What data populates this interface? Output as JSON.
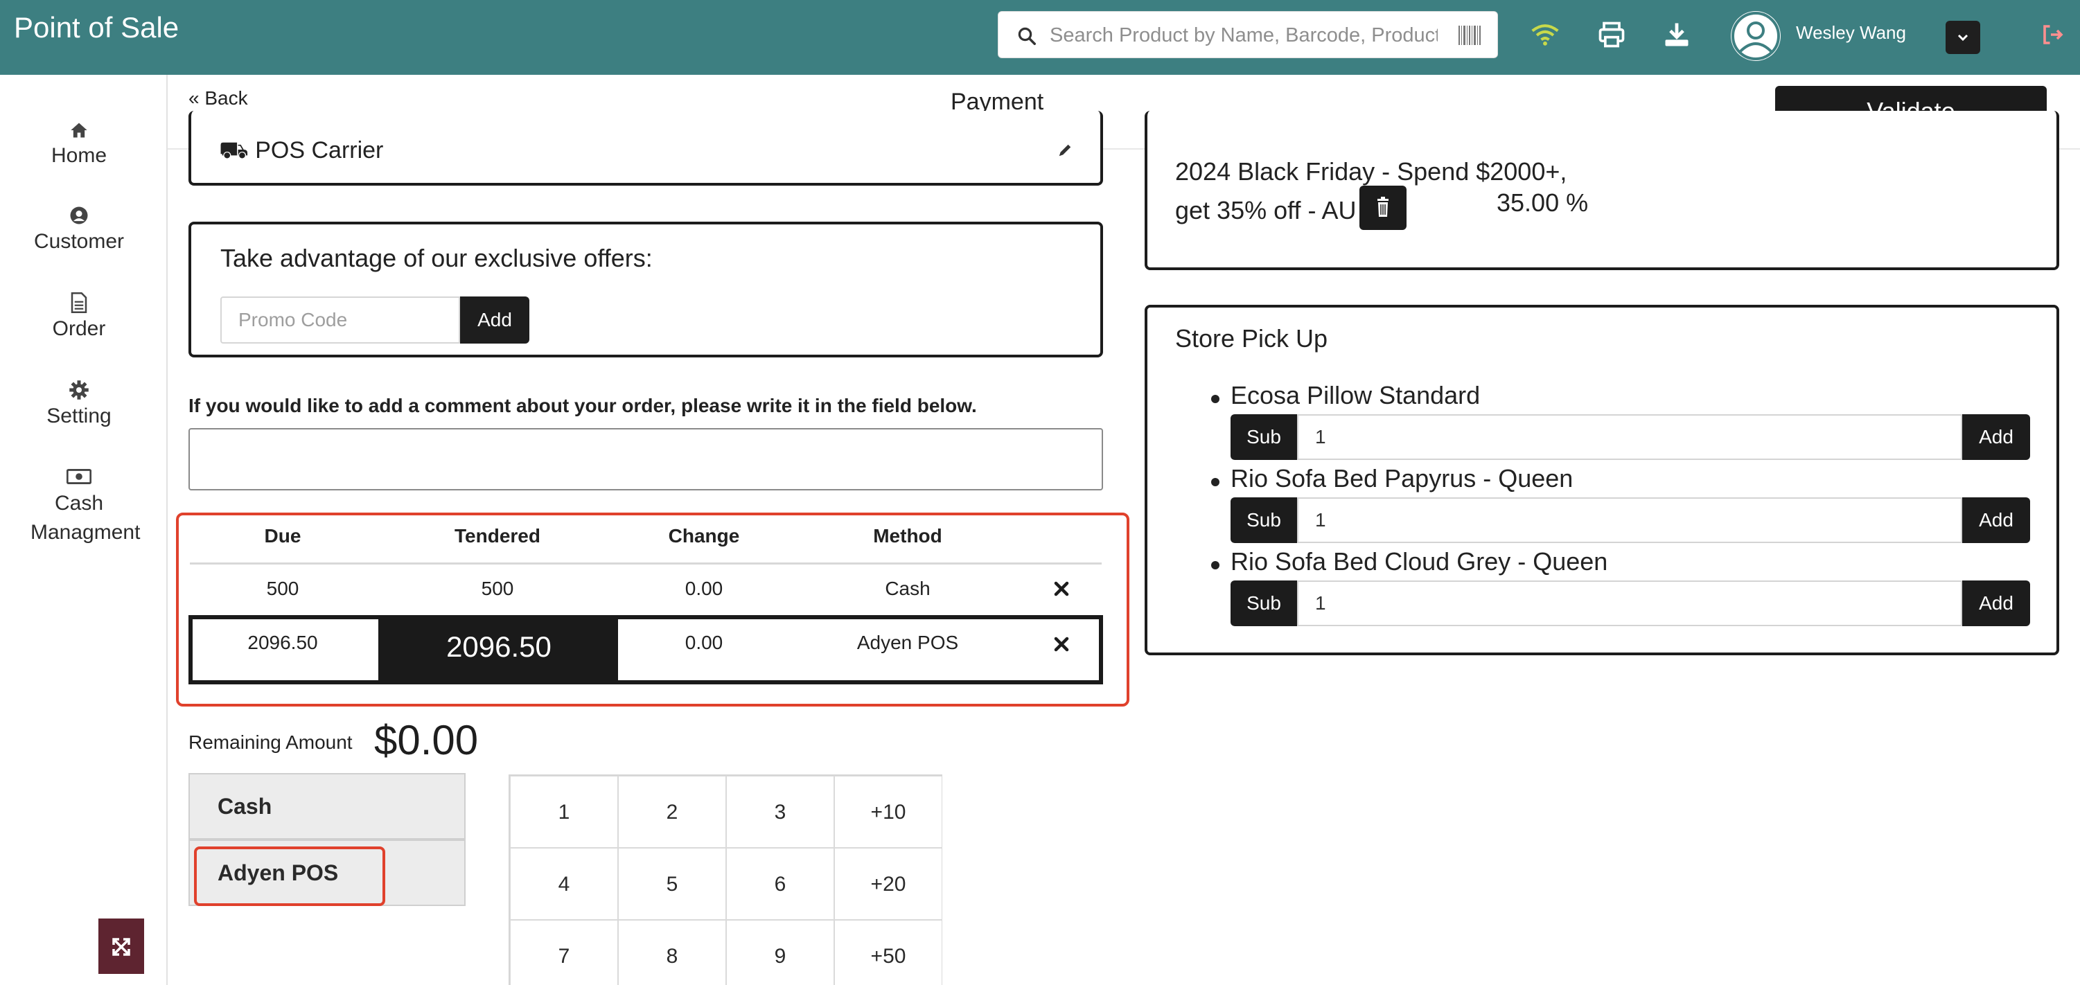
{
  "app": {
    "title": "Point of Sale"
  },
  "search": {
    "placeholder": "Search Product by Name, Barcode, Product I"
  },
  "user": {
    "name": "Wesley Wang"
  },
  "sidebar": {
    "items": [
      {
        "label": "Home",
        "icon": "home-icon"
      },
      {
        "label": "Customer",
        "icon": "user-circle-icon"
      },
      {
        "label": "Order",
        "icon": "document-icon"
      },
      {
        "label": "Setting",
        "icon": "gear-icon"
      },
      {
        "label": "Cash Managment",
        "icon": "cash-icon"
      }
    ]
  },
  "header": {
    "back_label": "Back",
    "title": "Payment",
    "validate_label": "Validate"
  },
  "carrier": {
    "label": "POS Carrier"
  },
  "offers": {
    "title": "Take advantage of our exclusive offers:",
    "promo_placeholder": "Promo Code",
    "add_label": "Add"
  },
  "comment": {
    "label": "If you would like to add a comment about your order, please write it in the field below."
  },
  "payments": {
    "columns": [
      "Due",
      "Tendered",
      "Change",
      "Method"
    ],
    "rows": [
      {
        "due": "500",
        "tendered": "500",
        "change": "0.00",
        "method": "Cash"
      },
      {
        "due": "2096.50",
        "tendered": "2096.50",
        "change": "0.00",
        "method": "Adyen POS"
      }
    ]
  },
  "remaining": {
    "label": "Remaining Amount",
    "value": "$0.00"
  },
  "methods": [
    "Cash",
    "Adyen POS"
  ],
  "keypad": {
    "keys": [
      "1",
      "2",
      "3",
      "+10",
      "4",
      "5",
      "6",
      "+20",
      "7",
      "8",
      "9",
      "+50"
    ]
  },
  "discount": {
    "text": "2024 Black Friday - Spend $2000+, get 35% off - AU",
    "percent": "35.00 %"
  },
  "pickup": {
    "title": "Store Pick Up",
    "sub_label": "Sub",
    "add_label": "Add",
    "items": [
      {
        "name": "Ecosa Pillow Standard",
        "qty": "1"
      },
      {
        "name": "Rio Sofa Bed Papyrus - Queen",
        "qty": "1"
      },
      {
        "name": "Rio Sofa Bed Cloud Grey - Queen",
        "qty": "1"
      }
    ]
  },
  "colors": {
    "topbar": "#3d7f81",
    "highlight": "#e0412c",
    "dark": "#1c1c1c",
    "wifi": "#c8d94a"
  }
}
